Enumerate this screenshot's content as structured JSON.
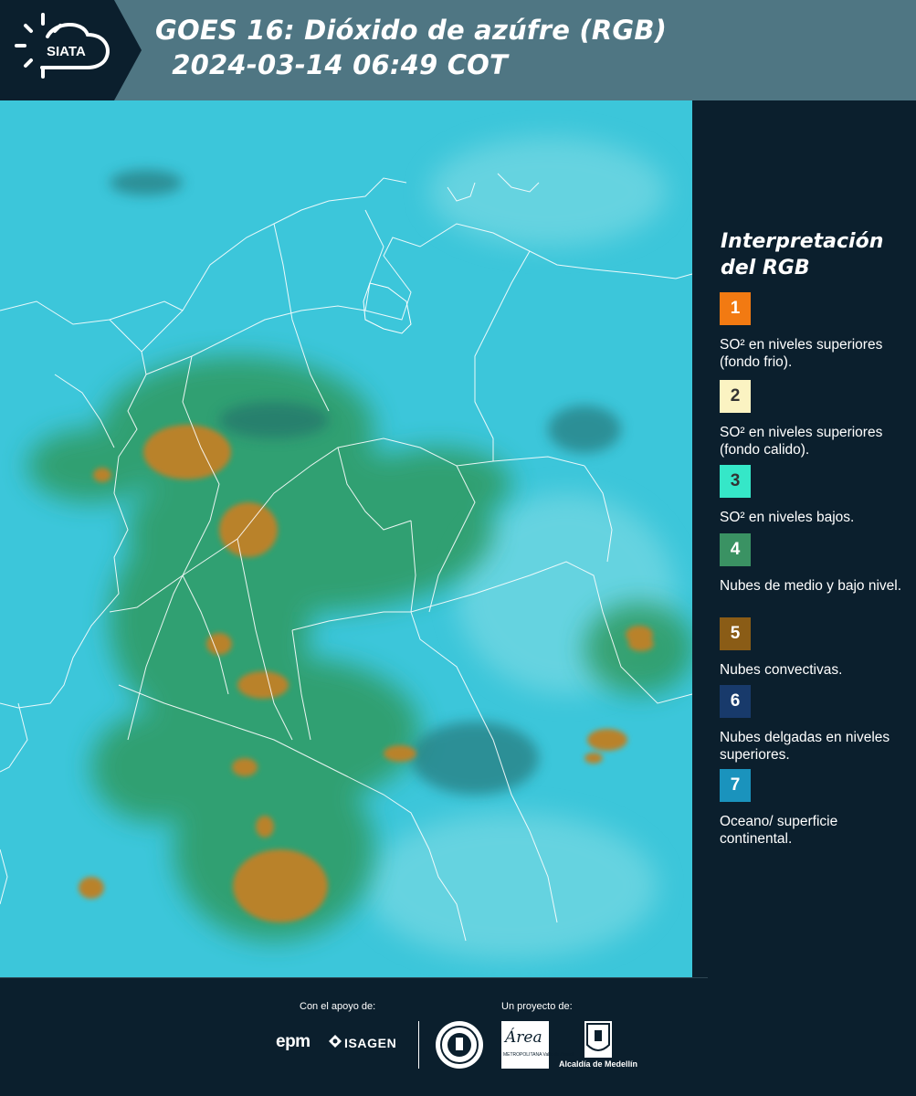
{
  "header": {
    "logo_text": "SIATA",
    "title_line1": "GOES 16: Dióxido de azúfre (RGB)",
    "title_line2": " 2024-03-14 06:49 COT",
    "background_color": "#4f7683",
    "logo_background_color": "#0b1f2d"
  },
  "legend": {
    "title": "Interpretación del RGB",
    "items": [
      {
        "number": "1",
        "color": "#f27a12",
        "number_color": "#ffffff",
        "label": "SO² en niveles superiores (fondo frio)."
      },
      {
        "number": "2",
        "color": "#fbf3c2",
        "number_color": "#333333",
        "label": "SO² en niveles superiores (fondo calido)."
      },
      {
        "number": "3",
        "color": "#35e7c8",
        "number_color": "#333333",
        "label": "SO² en niveles bajos."
      },
      {
        "number": "4",
        "color": "#3a9263",
        "number_color": "#ffffff",
        "label": "Nubes de medio y bajo nivel."
      },
      {
        "number": "5",
        "color": "#8a5c16",
        "number_color": "#ffffff",
        "label": "Nubes convectivas."
      },
      {
        "number": "6",
        "color": "#183a6b",
        "number_color": "#ffffff",
        "label": "Nubes delgadas en niveles superiores."
      },
      {
        "number": "7",
        "color": "#1a93bd",
        "number_color": "#ffffff",
        "label": "Oceano/ superficie continental."
      }
    ]
  },
  "footer": {
    "support_label": "Con el apoyo de:",
    "project_label": "Un proyecto de:",
    "epm_text": "epm",
    "isagen_text": "ISAGEN",
    "area_text": "Área",
    "area_sub": "METROPOLITANA Valle de Aburrá",
    "medellin_label": "Alcaldía de Medellín"
  },
  "map": {
    "base_color": "#38c4d8",
    "cloud_low_color": "#2e9a5c",
    "convective_color": "#b07d2a"
  }
}
